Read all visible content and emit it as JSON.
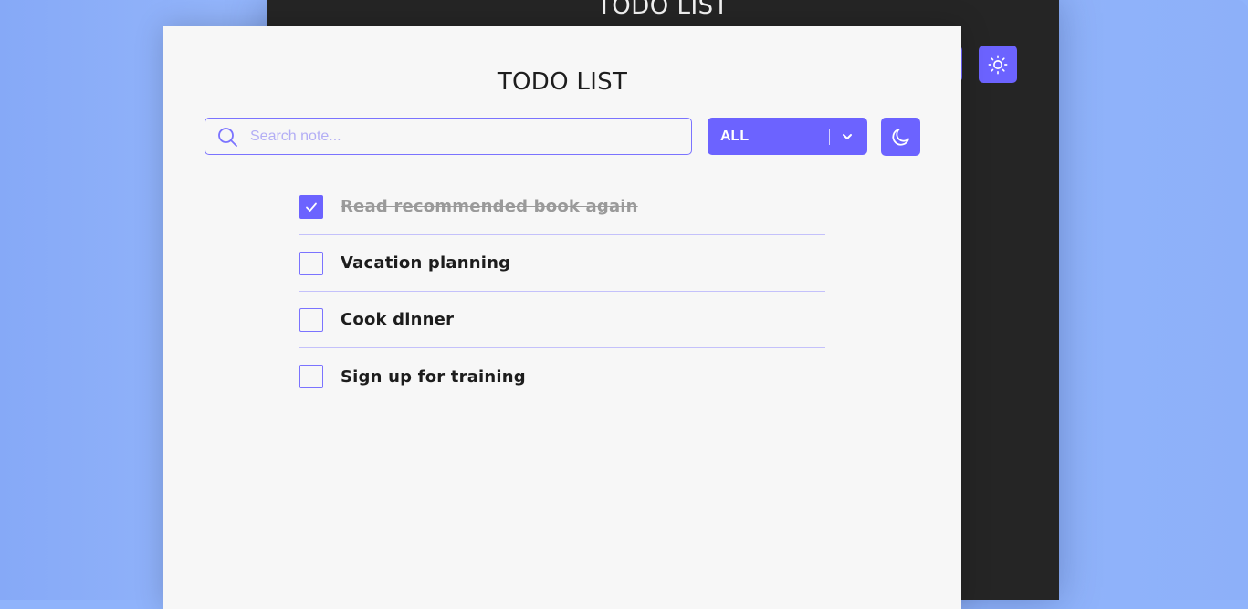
{
  "app": {
    "title": "TODO LIST"
  },
  "dark_preview": {
    "title": "TODO LIST",
    "theme_icon": "sun-icon"
  },
  "search": {
    "placeholder": "Search note...",
    "value": "",
    "icon": "search-icon"
  },
  "filter": {
    "selected": "ALL",
    "icon": "chevron-down-icon"
  },
  "theme_toggle": {
    "icon": "moon-icon"
  },
  "colors": {
    "accent": "#6c63ff",
    "background": "#f7f7f7",
    "dark_background": "#252525",
    "page": "#93b6fb"
  },
  "todos": [
    {
      "label": "Read recommended book again",
      "done": true
    },
    {
      "label": "Vacation planning",
      "done": false
    },
    {
      "label": "Cook dinner",
      "done": false
    },
    {
      "label": "Sign up for training",
      "done": false
    }
  ]
}
